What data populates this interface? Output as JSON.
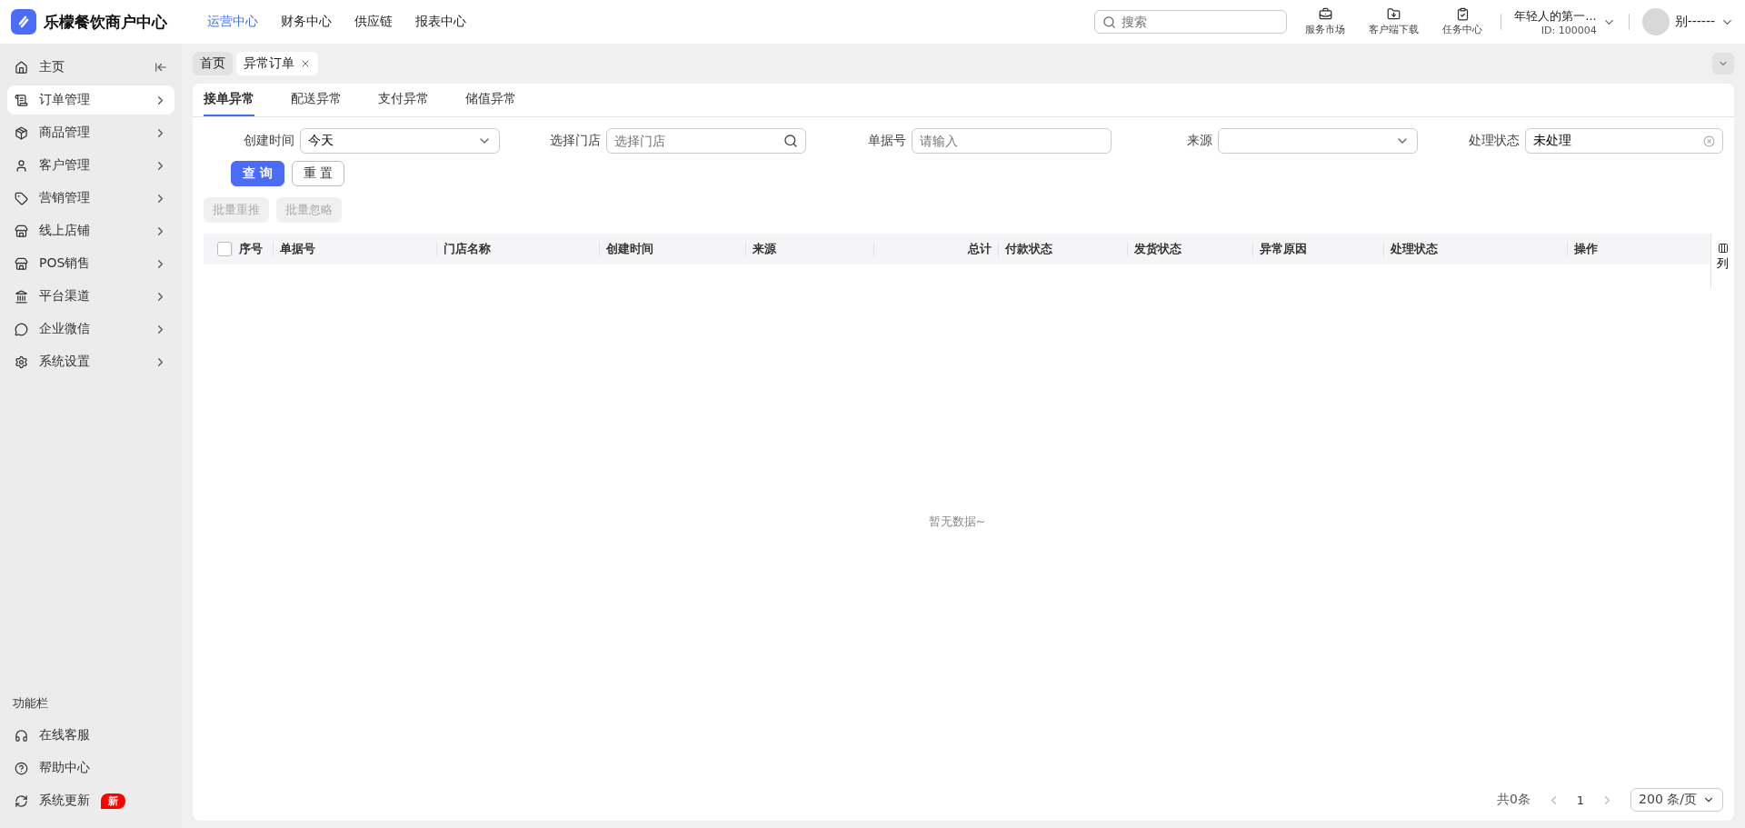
{
  "brand": {
    "name": "乐檬餐饮商户中心"
  },
  "top_nav": [
    {
      "label": "运营中心",
      "selected": true
    },
    {
      "label": "财务中心",
      "selected": false
    },
    {
      "label": "供应链",
      "selected": false
    },
    {
      "label": "报表中心",
      "selected": false
    }
  ],
  "search": {
    "placeholder": "搜索"
  },
  "shortcuts": [
    {
      "kind": "bag",
      "label": "服务市场"
    },
    {
      "kind": "download",
      "label": "客户端下载"
    },
    {
      "kind": "task",
      "label": "任务中心"
    }
  ],
  "org": {
    "name": "年轻人的第一...",
    "id": "ID: 100004"
  },
  "user": {
    "name": "别------"
  },
  "sidebar": {
    "items": [
      {
        "kind": "home",
        "label": "主页",
        "selected": false,
        "collapse": true
      },
      {
        "kind": "order",
        "label": "订单管理",
        "selected": true
      },
      {
        "kind": "goods",
        "label": "商品管理",
        "selected": false
      },
      {
        "kind": "user",
        "label": "客户管理",
        "selected": false
      },
      {
        "kind": "tag",
        "label": "营销管理",
        "selected": false
      },
      {
        "kind": "shop",
        "label": "线上店铺",
        "selected": false
      },
      {
        "kind": "shop",
        "label": "POS销售",
        "selected": false
      },
      {
        "kind": "bank",
        "label": "平台渠道",
        "selected": false
      },
      {
        "kind": "chat",
        "label": "企业微信",
        "selected": false
      },
      {
        "kind": "gear",
        "label": "系统设置",
        "selected": false
      }
    ],
    "footer_title": "功能栏",
    "footer_items": [
      {
        "kind": "service",
        "label": "在线客服"
      },
      {
        "kind": "help",
        "label": "帮助中心"
      },
      {
        "kind": "update",
        "label": "系统更新",
        "badge": "新"
      }
    ]
  },
  "page_tabs": [
    {
      "label": "首页",
      "selected": false,
      "closable": false
    },
    {
      "label": "异常订单",
      "selected": true,
      "closable": true
    }
  ],
  "sub_tabs": [
    {
      "label": "接单异常",
      "selected": true
    },
    {
      "label": "配送异常",
      "selected": false
    },
    {
      "label": "支付异常",
      "selected": false
    },
    {
      "label": "储值异常",
      "selected": false
    }
  ],
  "filters": [
    {
      "kind": "select",
      "label": "创建时间",
      "value": "今天"
    },
    {
      "kind": "search",
      "label": "选择门店",
      "placeholder": "选择门店"
    },
    {
      "kind": "input",
      "label": "单据号",
      "placeholder": "请输入"
    },
    {
      "kind": "select",
      "label": "来源"
    },
    {
      "kind": "clear",
      "label": "处理状态",
      "value": "未处理"
    }
  ],
  "actions": [
    {
      "kind": "primary",
      "label": "查 询"
    },
    {
      "kind": "default",
      "label": "重 置"
    }
  ],
  "batch_actions": [
    {
      "label": "批量重推",
      "disabled": true
    },
    {
      "label": "批量忽略",
      "disabled": true
    }
  ],
  "table": {
    "select_all": {
      "checked": false
    },
    "columns": [
      {
        "label": "序号",
        "kind": "text"
      },
      {
        "label": "单据号",
        "kind": "text"
      },
      {
        "label": "门店名称",
        "kind": "text"
      },
      {
        "label": "创建时间",
        "kind": "text"
      },
      {
        "label": "来源",
        "kind": "text"
      },
      {
        "label": "总计",
        "kind": "number"
      },
      {
        "label": "付款状态",
        "kind": "text"
      },
      {
        "label": "发货状态",
        "kind": "text"
      },
      {
        "label": "异常原因",
        "kind": "text"
      },
      {
        "label": "处理状态",
        "kind": "text"
      },
      {
        "label": "操作",
        "kind": "action"
      }
    ],
    "empty_text": "暂无数据~",
    "column_setting": "列"
  },
  "pagination": {
    "total": "共0条",
    "page": "1",
    "page_size": "200 条/页"
  }
}
